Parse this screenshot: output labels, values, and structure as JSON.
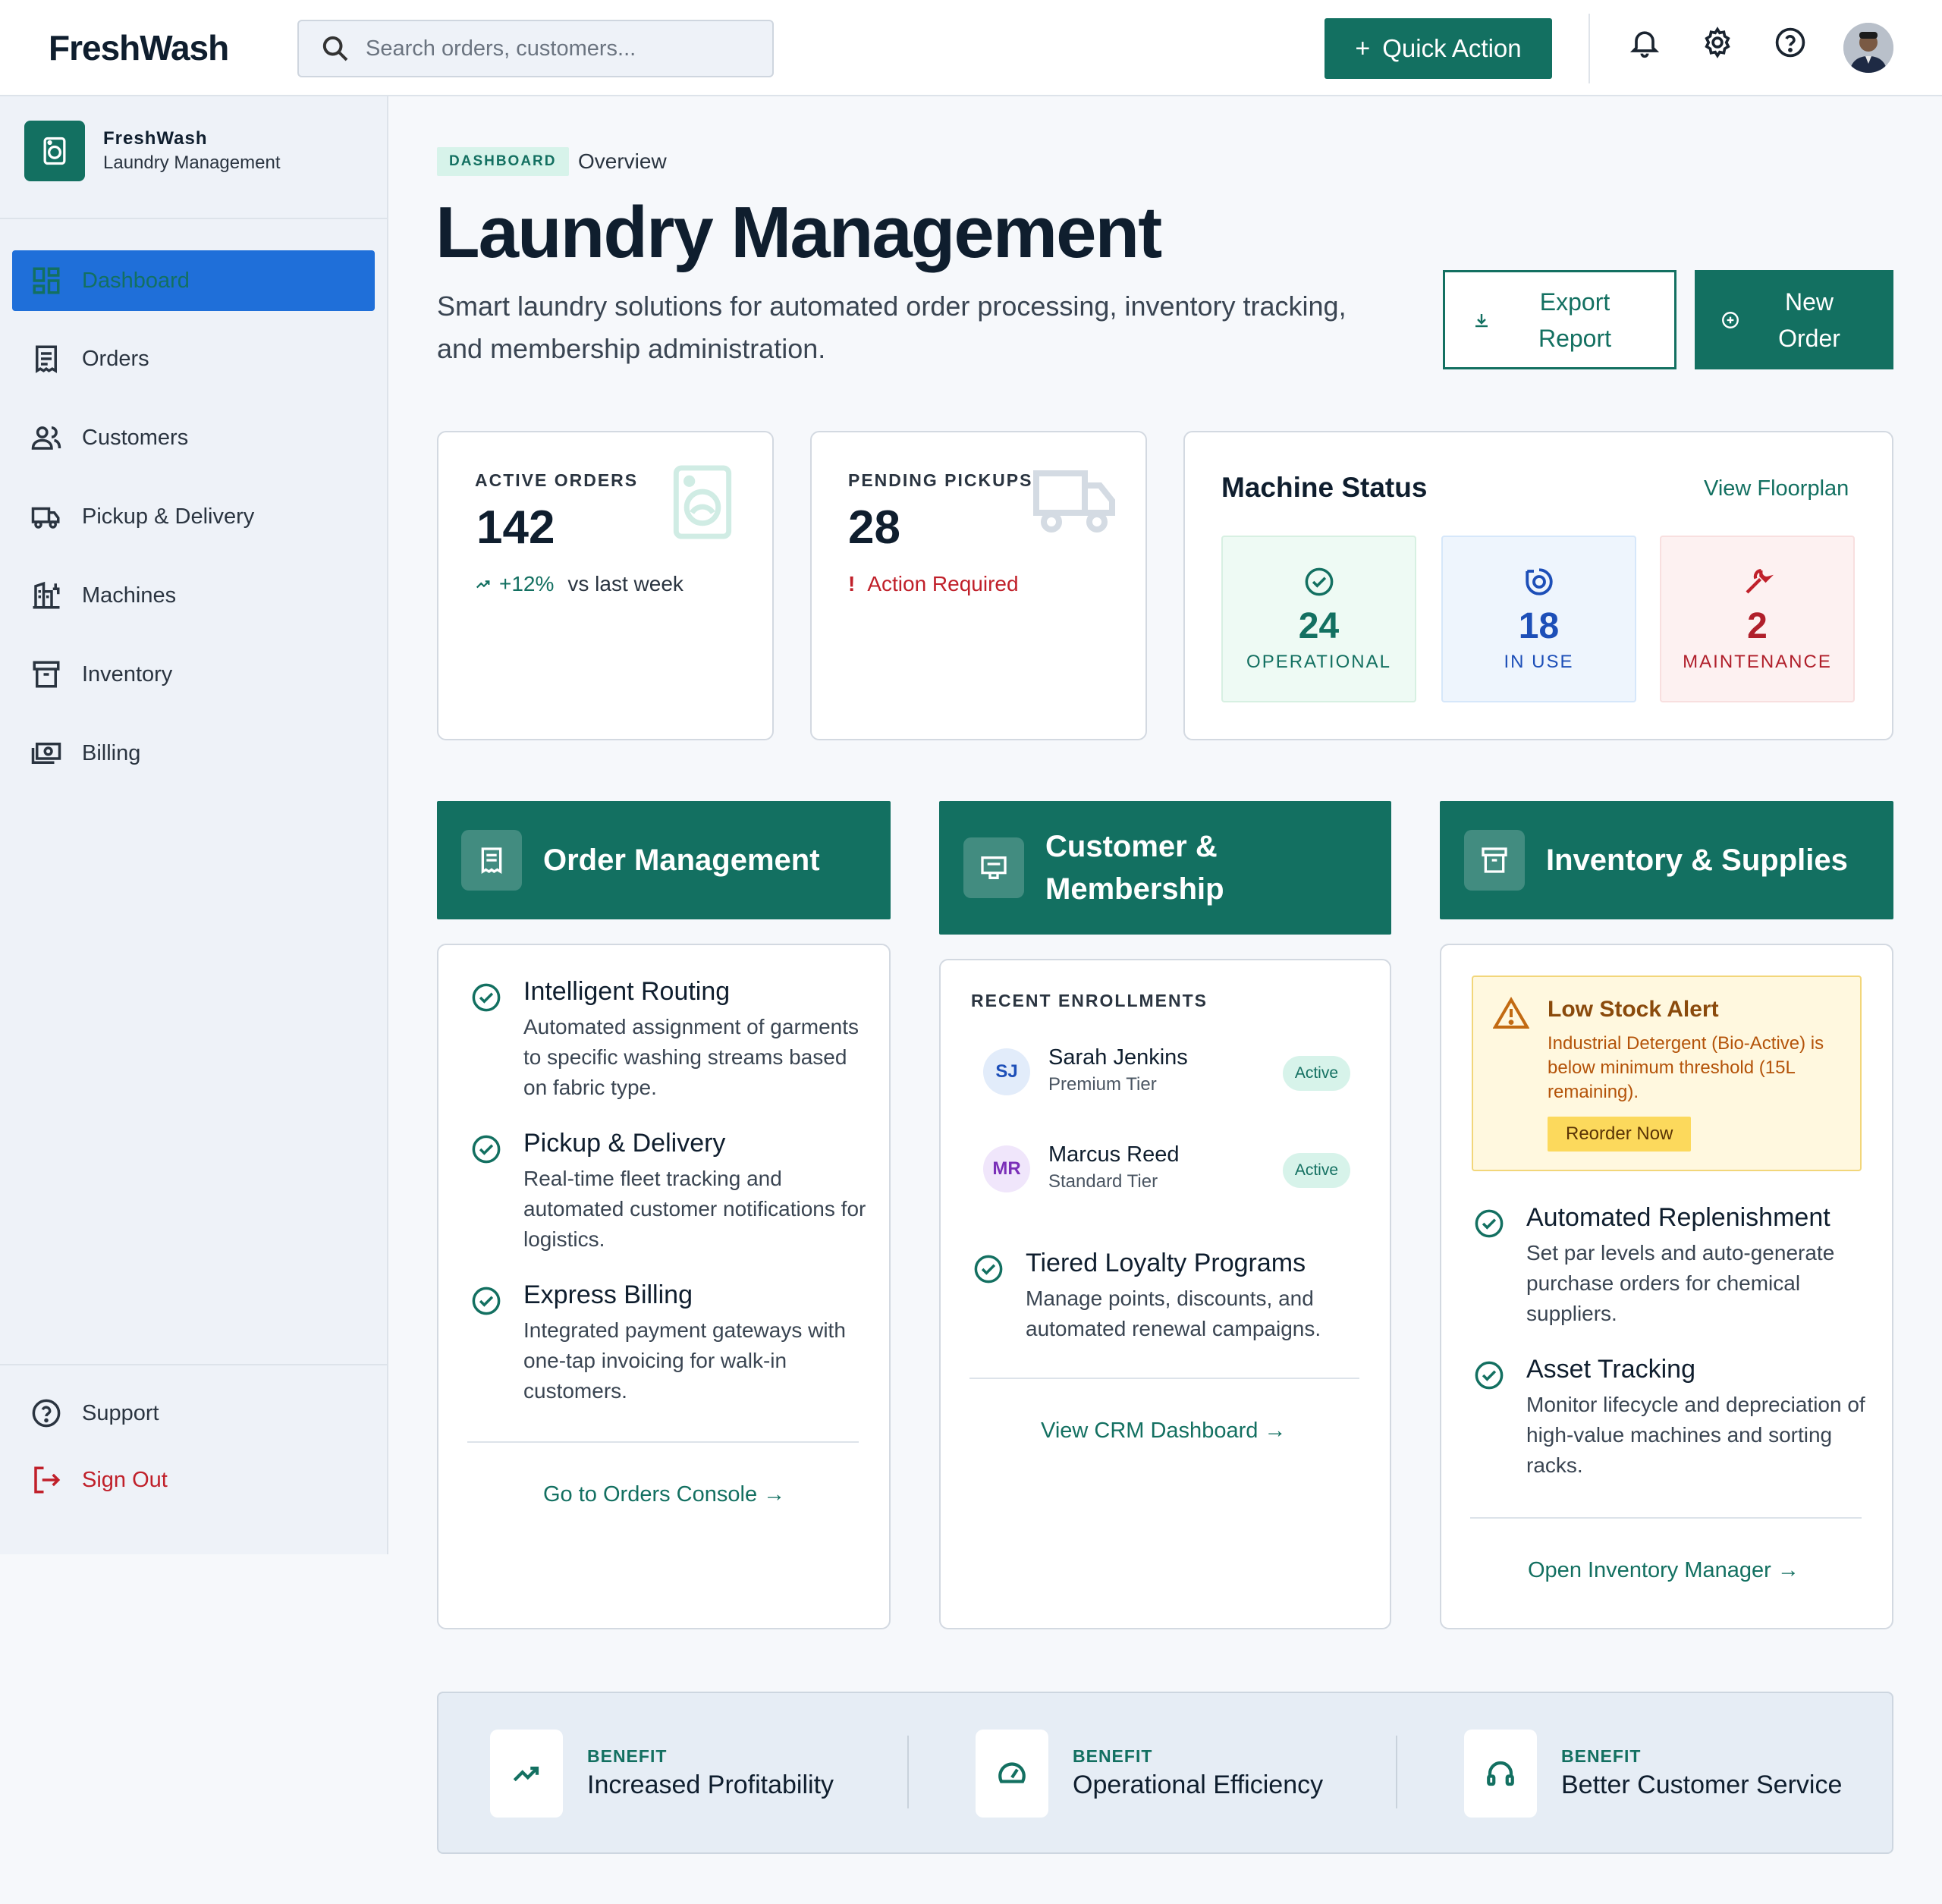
{
  "header": {
    "logo": "FreshWash",
    "search_placeholder": "Search orders, customers...",
    "quick_action": "Quick Action"
  },
  "sidebar": {
    "brand_name": "FreshWash",
    "brand_sub": "Laundry Management",
    "items": [
      {
        "label": "Dashboard"
      },
      {
        "label": "Orders"
      },
      {
        "label": "Customers"
      },
      {
        "label": "Pickup & Delivery"
      },
      {
        "label": "Machines"
      },
      {
        "label": "Inventory"
      },
      {
        "label": "Billing"
      }
    ],
    "support": "Support",
    "sign_out": "Sign Out"
  },
  "page": {
    "tag": "DASHBOARD",
    "crumb": "Overview",
    "title": "Laundry Management",
    "subtitle": "Smart laundry solutions for automated order processing, inventory tracking, and membership administration.",
    "export_l1": "Export",
    "export_l2": "Report",
    "new_l1": "New",
    "new_l2": "Order"
  },
  "kpis": {
    "active_label": "ACTIVE ORDERS",
    "active_value": "142",
    "active_delta": "+12%",
    "active_delta_text": "vs last week",
    "pending_label": "PENDING PICKUPS",
    "pending_value": "28",
    "pending_note": "Action Required"
  },
  "machine": {
    "title": "Machine Status",
    "link": "View Floorplan",
    "operational": "24",
    "operational_label": "OPERATIONAL",
    "in_use": "18",
    "in_use_label": "IN USE",
    "maintenance": "2",
    "maintenance_label": "MAINTENANCE"
  },
  "orders": {
    "title": "Order Management",
    "features": [
      {
        "title": "Intelligent Routing",
        "desc": "Automated assignment of garments to specific washing streams based on fabric type."
      },
      {
        "title": "Pickup & Delivery",
        "desc": "Real-time fleet tracking and automated customer notifications for logistics."
      },
      {
        "title": "Express Billing",
        "desc": "Integrated payment gateways with one-tap invoicing for walk-in customers."
      }
    ],
    "link": "Go to Orders Console →"
  },
  "crm": {
    "title_l1": "Customer &",
    "title_l2": "Membership",
    "recent": "RECENT ENROLLMENTS",
    "enrollments": [
      {
        "initials": "SJ",
        "name": "Sarah Jenkins",
        "tier": "Premium Tier",
        "status": "Active"
      },
      {
        "initials": "MR",
        "name": "Marcus Reed",
        "tier": "Standard Tier",
        "status": "Active"
      }
    ],
    "feature_title": "Tiered Loyalty Programs",
    "feature_desc": "Manage points, discounts, and automated renewal campaigns.",
    "link": "View CRM Dashboard →"
  },
  "inventory": {
    "title": "Inventory & Supplies",
    "alert_title": "Low Stock Alert",
    "alert_text": "Industrial Detergent (Bio-Active) is below minimum threshold (15L remaining).",
    "reorder": "Reorder Now",
    "features": [
      {
        "title": "Automated Replenishment",
        "desc": "Set par levels and auto-generate purchase orders for chemical suppliers."
      },
      {
        "title": "Asset Tracking",
        "desc": "Monitor lifecycle and depreciation of high-value machines and sorting racks."
      }
    ],
    "link": "Open Inventory Manager →"
  },
  "benefits": [
    {
      "label": "BENEFIT",
      "title": "Increased Profitability"
    },
    {
      "label": "BENEFIT",
      "title": "Operational Efficiency"
    },
    {
      "label": "BENEFIT",
      "title": "Better Customer Service"
    }
  ],
  "colors": {
    "brand": "#137061",
    "active_nav": "#1f6fd9",
    "danger": "#c0202a",
    "warning": "#b45309"
  }
}
